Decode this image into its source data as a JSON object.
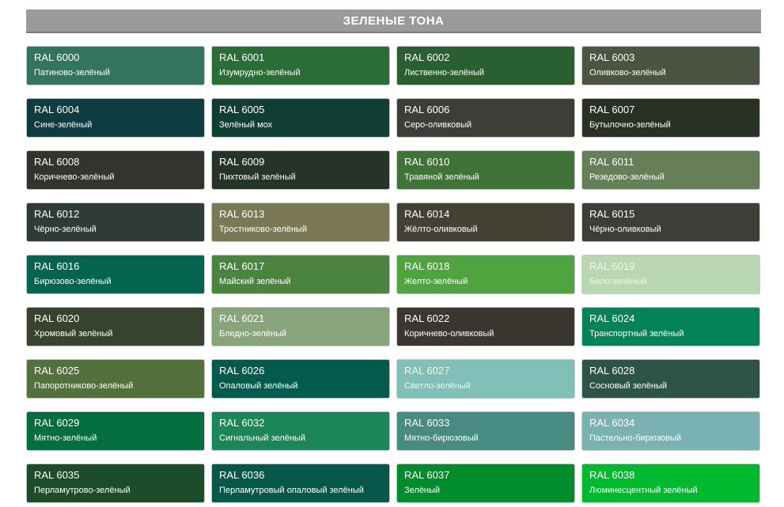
{
  "header": {
    "title": "ЗЕЛЕНЫЕ ТОНА"
  },
  "swatches": [
    {
      "code": "RAL 6000",
      "name": "Патиново-зелёный",
      "color": "#33745f"
    },
    {
      "code": "RAL 6001",
      "name": "Изумрудно-зелёный",
      "color": "#2a6d37"
    },
    {
      "code": "RAL 6002",
      "name": "Лиственно-зелёный",
      "color": "#2a5f32"
    },
    {
      "code": "RAL 6003",
      "name": "Оливково-зелёный",
      "color": "#4b5440"
    },
    {
      "code": "RAL 6004",
      "name": "Сине-зелёный",
      "color": "#0e3c40"
    },
    {
      "code": "RAL 6005",
      "name": "Зелёный мох",
      "color": "#113e33"
    },
    {
      "code": "RAL 6006",
      "name": "Серо-оливковый",
      "color": "#3c3e38"
    },
    {
      "code": "RAL 6007",
      "name": "Бутылочно-зелёный",
      "color": "#293024"
    },
    {
      "code": "RAL 6008",
      "name": "Коричнево-зелёный",
      "color": "#33342d"
    },
    {
      "code": "RAL 6009",
      "name": "Пихтовый зелёный",
      "color": "#263329"
    },
    {
      "code": "RAL 6010",
      "name": "Травяной зелёный",
      "color": "#3f7338"
    },
    {
      "code": "RAL 6011",
      "name": "Резедово-зелёный",
      "color": "#667f56"
    },
    {
      "code": "RAL 6012",
      "name": "Чёрно-зелёный",
      "color": "#2f3b39"
    },
    {
      "code": "RAL 6013",
      "name": "Тростниково-зелёный",
      "color": "#7b7955"
    },
    {
      "code": "RAL 6014",
      "name": "Жёлто-оливковый",
      "color": "#454034"
    },
    {
      "code": "RAL 6015",
      "name": "Чёрно-оливковый",
      "color": "#3d3e38"
    },
    {
      "code": "RAL 6016",
      "name": "Бирюзово-зелёный",
      "color": "#04644f"
    },
    {
      "code": "RAL 6017",
      "name": "Майский зелёный",
      "color": "#4b8441"
    },
    {
      "code": "RAL 6018",
      "name": "Желто-зелёный",
      "color": "#4fa43f"
    },
    {
      "code": "RAL 6019",
      "name": "Бело-зелёный",
      "color": "#b9d7b1",
      "light": true
    },
    {
      "code": "RAL 6020",
      "name": "Хромовый зелёный",
      "color": "#38432f"
    },
    {
      "code": "RAL 6021",
      "name": "Бледно-зелёный",
      "color": "#88a47b"
    },
    {
      "code": "RAL 6022",
      "name": "Коричнево-оливковый",
      "color": "#3c3630"
    },
    {
      "code": "RAL 6024",
      "name": "Транспортный зелёный",
      "color": "#058358"
    },
    {
      "code": "RAL 6025",
      "name": "Папоротниково-зелёный",
      "color": "#53703d"
    },
    {
      "code": "RAL 6026",
      "name": "Опаловый зелёный",
      "color": "#035b4e"
    },
    {
      "code": "RAL 6027",
      "name": "Светло-зелёный",
      "color": "#81c0b8",
      "light": true
    },
    {
      "code": "RAL 6028",
      "name": "Сосновый зелёный",
      "color": "#2e5446"
    },
    {
      "code": "RAL 6029",
      "name": "Мятно-зелёный",
      "color": "#056e3e"
    },
    {
      "code": "RAL 6032",
      "name": "Сигнальный зелёный",
      "color": "#1b8658"
    },
    {
      "code": "RAL 6033",
      "name": "Мятно-бирюзовый",
      "color": "#478b82"
    },
    {
      "code": "RAL 6034",
      "name": "Пастельно-бирюзовый",
      "color": "#7ab1b2"
    },
    {
      "code": "RAL 6035",
      "name": "Перламутрово-зелёный",
      "color": "#1c4c2a"
    },
    {
      "code": "RAL 6036",
      "name": "Перламутровый опаловый зелёный",
      "color": "#07584a"
    },
    {
      "code": "RAL 6037",
      "name": "Зелёный",
      "color": "#008b2c"
    },
    {
      "code": "RAL 6038",
      "name": "Люминесцентный зелёный",
      "color": "#01b92e"
    }
  ]
}
